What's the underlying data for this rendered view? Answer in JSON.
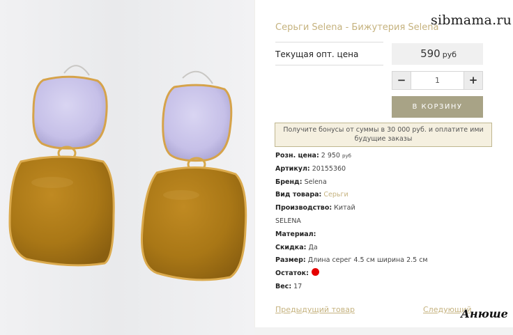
{
  "product": {
    "title": "Серьги Selena - Бижутерия Selena",
    "watermark": "sibmama.ru",
    "price_label": "Текущая опт. цена",
    "price_value": "590",
    "price_currency": "руб",
    "quantity_value": "1",
    "minus_label": "−",
    "plus_label": "+",
    "cart_label": "В КОРЗИНУ",
    "bonus_text": "Получите бонусы от суммы в 30 000 руб. и оплатите ими будущие заказы"
  },
  "specs": {
    "retail_label": "Розн. цена:",
    "retail_value": "2 950",
    "retail_currency": "руб",
    "article_label": "Артикул:",
    "article_value": "20155360",
    "brand_label": "Бренд:",
    "brand_value": "Selena",
    "type_label": "Вид товара:",
    "type_value": "Серьги",
    "origin_label": "Производство:",
    "origin_value": "Китай",
    "brand_extra": "SELENA",
    "material_label": "Материал:",
    "discount_label": "Скидка:",
    "discount_value": "Да",
    "size_label": "Размер:",
    "size_value": "Длина серег 4.5 см ширина 2.5 см",
    "stock_label": "Остаток:",
    "weight_label": "Вес:",
    "weight_value": "17"
  },
  "nav": {
    "prev_label": "Предыдущий товар",
    "next_label": "Следующий",
    "signature": "Анюше"
  },
  "colors": {
    "accent_gold": "#c5b27e",
    "cart_button": "#a8a386",
    "stock_indicator": "#e50000",
    "lilac_enamel": "#c8c3ea",
    "mustard_enamel": "#b07f1c"
  }
}
